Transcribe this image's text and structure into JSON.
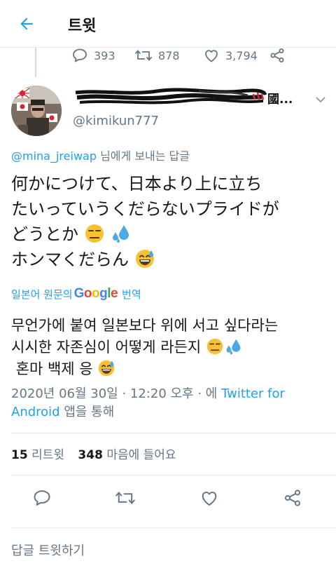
{
  "header": {
    "title": "트윗"
  },
  "previous_tweet": {
    "replies": "393",
    "retweets": "878",
    "likes": "3,794"
  },
  "tweet": {
    "display_name": "",
    "name_suffix": "國...",
    "handle": "@kimikun777",
    "reply_to": {
      "mention": "@mina_jreiwap",
      "suffix": " 님에게 보내는 답글"
    },
    "text_lines": [
      "何かにつけて、日本より上に立ち",
      "たいっていうくだらないプライドが",
      "どうとか",
      "ホンマくだらん"
    ],
    "translate": {
      "prefix": "일본어 원문의",
      "brand": "Google",
      "suffix": "번역"
    },
    "translated_lines": [
      "무언가에 붙여 일본보다 위에 서고 싶다라는",
      "시시한 자존심이 어떻게 라든지",
      " 혼마 백제 응"
    ],
    "timestamp": "2020년 06월 30일 · 12:20 오후 · 에 ",
    "source_label": "Twitter for Android",
    "source_suffix": " 앱을 통해"
  },
  "stats": {
    "retweets_count": "15",
    "retweets_label": "리트윗",
    "likes_count": "348",
    "likes_label": "마음에 들어요"
  },
  "compose": {
    "placeholder": "답글 트윗하기"
  },
  "colors": {
    "accent": "#1da1f2",
    "text_primary": "#14171a",
    "text_secondary": "#657786",
    "divider": "#e6ecf0",
    "scribble": "#d4272f"
  },
  "icons": {
    "back": "arrow-left-icon",
    "reply": "reply-icon",
    "retweet": "retweet-icon",
    "like": "heart-icon",
    "share": "share-icon",
    "caret": "chevron-down-icon",
    "emoji_1": "unamused-face-emoji",
    "emoji_2": "sweat-droplets-emoji",
    "emoji_3": "grinning-face-with-sweat-emoji"
  }
}
